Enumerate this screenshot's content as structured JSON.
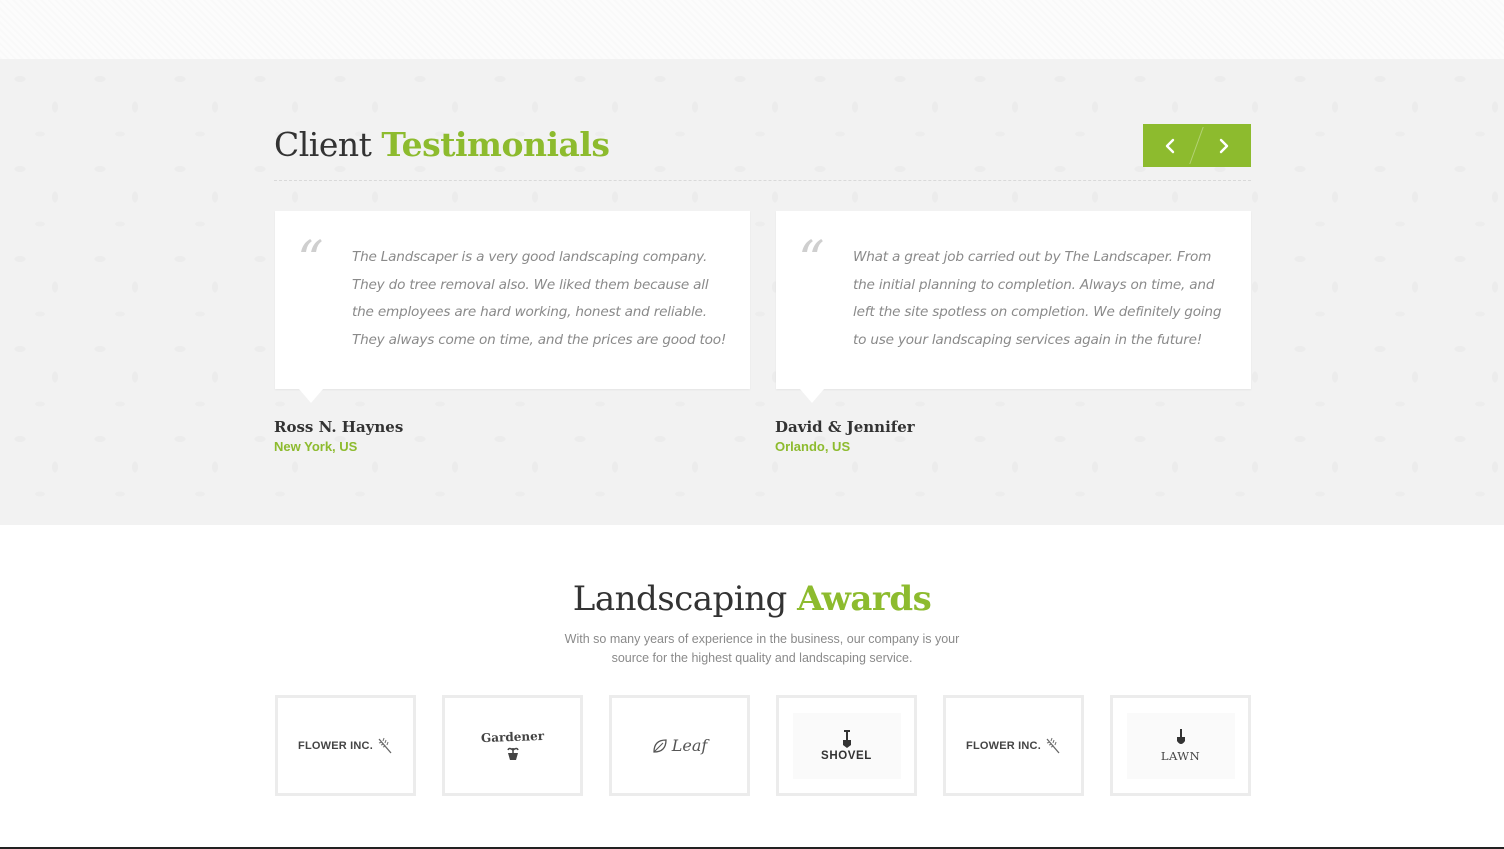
{
  "testimonials": {
    "title_plain": "Client",
    "title_accent": "Testimonials",
    "items": [
      {
        "quote": "The Landscaper is a very good landscaping company. They do tree removal also. We liked them because all the employees are hard working, honest and reliable. They always come on time, and the prices are good too!",
        "name": "Ross N. Haynes",
        "location": "New York, US"
      },
      {
        "quote": "What a great job carried out by The Landscaper. From the initial planning to completion. Always on time, and left the site spotless on completion. We definitely going to use your landscaping services again in the future!",
        "name": "David & Jennifer",
        "location": "Orlando, US"
      }
    ],
    "nav": {
      "prev_icon": "chevron-left-icon",
      "next_icon": "chevron-right-icon"
    }
  },
  "awards": {
    "title_plain": "Landscaping",
    "title_accent": "Awards",
    "subtitle": "With so many years of experience in the business, our company is your source for the highest quality and landscaping service.",
    "logos": [
      {
        "text": "FLOWER INC.",
        "icon": "wheat-icon"
      },
      {
        "text": "Gardener",
        "icon": "plant-pot-icon"
      },
      {
        "text": "Leaf",
        "icon": "leaf-icon"
      },
      {
        "text": "SHOVEL",
        "icon": "shovel-icon"
      },
      {
        "text": "FLOWER INC.",
        "icon": "wheat-icon"
      },
      {
        "text": "LAWN",
        "icon": "spade-icon"
      }
    ]
  },
  "colors": {
    "accent": "#8dbb2e",
    "text": "#333333",
    "muted": "#8a8a8a"
  }
}
